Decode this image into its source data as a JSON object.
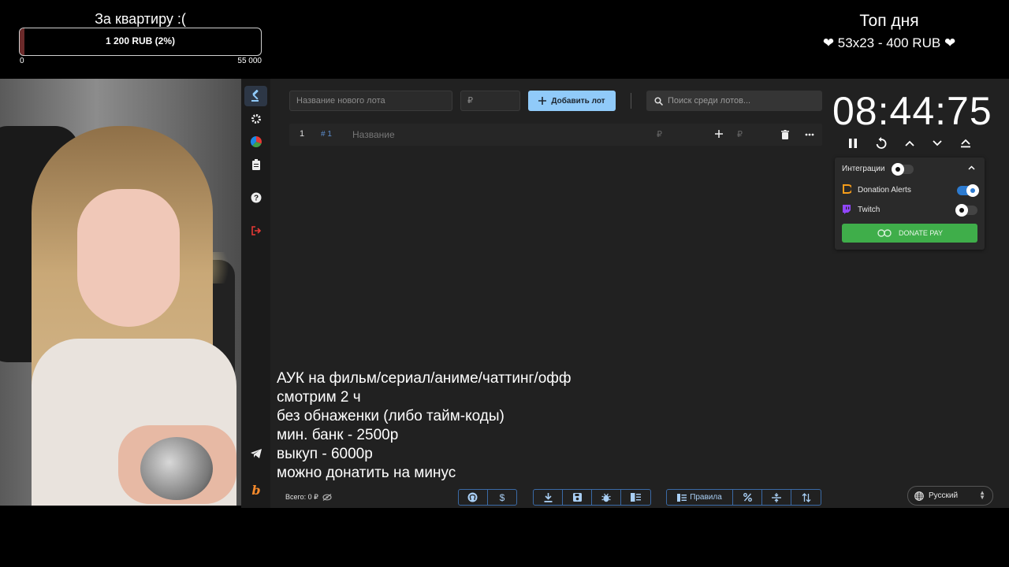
{
  "goal": {
    "title": "За квартиру :(",
    "amount_text": "1 200 RUB (2%)",
    "progress_percent": 2,
    "min_label": "0",
    "max_label": "55 000"
  },
  "top_day": {
    "title": "Топ дня",
    "entry": "53x23 - 400 RUB",
    "heart": "❤"
  },
  "toolbar": {
    "new_lot_placeholder": "Название нового лота",
    "amount_placeholder": "₽",
    "add_lot_label": "Добавить лот",
    "search_placeholder": "Поиск среди лотов..."
  },
  "lot": {
    "index": "1",
    "id": "# 1",
    "name_placeholder": "Название",
    "amount_placeholder": "₽",
    "add_amount_placeholder": "₽"
  },
  "timer": {
    "value": "08:44:75"
  },
  "integrations": {
    "title": "Интеграции",
    "items": [
      {
        "name": "Donation Alerts",
        "enabled": true
      },
      {
        "name": "Twitch",
        "enabled": false
      }
    ],
    "donate_button": "DONATE PAY"
  },
  "rules_text": [
    "АУК на фильм/сериал/аниме/чаттинг/офф",
    "смотрим 2 ч",
    "без обнаженки (либо тайм-коды)",
    "мин. банк - 2500р",
    "выкуп - 6000р",
    "можно донатить на минус"
  ],
  "footer": {
    "total": "Всего: 0 ₽",
    "rules_button": "Правила",
    "language": "Русский"
  },
  "colors": {
    "accent": "#90caf9",
    "donate_green": "#3fae4a",
    "goal_fill": "#6b2a2a",
    "background": "#212121"
  },
  "icons": [
    "gavel-icon",
    "gear-icon",
    "pie-chart-icon",
    "clipboard-icon",
    "help-icon",
    "logout-icon",
    "telegram-icon",
    "brand-b-icon",
    "plus-icon",
    "search-icon",
    "trash-icon",
    "more-icon",
    "pause-icon",
    "restart-icon",
    "chevron-up-icon",
    "chevron-down-icon",
    "eject-icon",
    "github-icon",
    "dollar-icon",
    "download-icon",
    "save-icon",
    "bug-icon",
    "columns-icon",
    "rules-icon",
    "percent-icon",
    "split-icon",
    "sort-icon",
    "globe-icon",
    "eye-off-icon"
  ]
}
